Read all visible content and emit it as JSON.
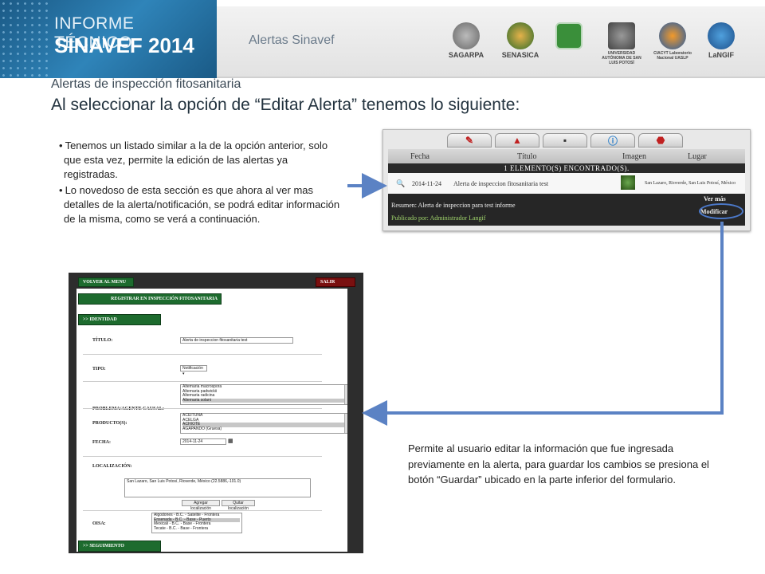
{
  "header": {
    "banner_line1": "INFORME TÉCNICO",
    "banner_line2": "SINAVEF 2014",
    "subtitle": "Alertas Sinavef",
    "logos": [
      {
        "name": "SAGARPA",
        "caption": "SAGARPA"
      },
      {
        "name": "SENASICA",
        "caption": "SENASICA"
      },
      {
        "name": "SINAVEF",
        "caption": ""
      },
      {
        "name": "UASLP",
        "caption": "UNIVERSIDAD AUTÓNOMA DE SAN LUIS POTOSÍ"
      },
      {
        "name": "CIACYT",
        "caption": "CIACYT Laboratorio Nacional UASLP"
      },
      {
        "name": "LaNGIF",
        "caption": "LaNGIF"
      }
    ]
  },
  "section_title": "Alertas de inspección fitosanitaria",
  "main_title": "Al seleccionar la opción de “Editar Alerta” tenemos lo siguiente:",
  "bullets": [
    "Tenemos un listado similar a la de la opción anterior, solo que esta vez, permite la edición de las alertas ya registradas.",
    "Lo novedoso de esta sección es que ahora al ver mas detalles de la alerta/notificación, se podrá editar información de la misma, como se verá a continuación."
  ],
  "note": "Permite al usuario editar la información que fue ingresada previamente en la alerta, para guardar los cambios se presiona el botón “Guardar” ubicado en la parte inferior del formulario.",
  "shot1": {
    "columns": [
      "Fecha",
      "Título",
      "Imagen",
      "Lugar"
    ],
    "found": "1 ELEMENTO(S) ENCONTRADO(S).",
    "row": {
      "date": "2014-11-24",
      "title": "Alerta de inspeccion fitosanitaria test",
      "place": "San Lazaro, Rioverde, San Luis Potosí, México"
    },
    "summary": "Resumen: Alerta de inspeccion para test informe",
    "published": "Publicado por: Administrador Langif",
    "more": "Ver más",
    "modify": "Modificar"
  },
  "shot2": {
    "back": "VOLVER AL MENU",
    "exit": "SALIR",
    "register": "REGISTRAR EN INSPECCIÓN FITOSANITARIA",
    "identity": ">> IDENTIDAD",
    "tracking": ">> SEGUIMIENTO",
    "labels": {
      "title": "TÍTULO:",
      "type": "TIPO:",
      "problem": "PROBLEMA/AGENTE CAUSAL:",
      "products": "PRODUCTO(S):",
      "date": "FECHA:",
      "location": "LOCALIZACIÓN:",
      "oisa": "OISA:"
    },
    "values": {
      "title": "Alerta de inspeccion fitosanitaria test",
      "type": "Notificación",
      "date": "2014-11-24",
      "location": "San Lazaro, San Luis Potosí,  Rioverde, México (22.5886,-101.0)"
    },
    "problem_options": [
      "Alternaria macrospora",
      "Alternaria padwickii",
      "Alternaria radicina",
      "Alternaria solani"
    ],
    "product_options": [
      "ACEITUNA",
      "ACELGA",
      "ACHIOTE",
      "AGAPANDO (Gruesa)"
    ],
    "oisa_options": [
      "Algodones - B.C. - Satelite - Frontera",
      "Ensenada - B.C. - Base - Puerto",
      "Mexicali - B.C. - Base - Frontera",
      "Tecate - B.C. - Base - Frontera"
    ],
    "add_location": "Agregar localización",
    "remove_location": "Quitar localización"
  }
}
